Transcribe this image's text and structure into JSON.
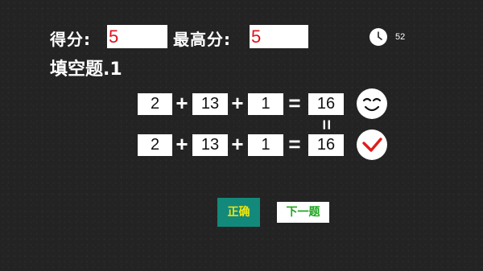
{
  "score": {
    "label": "得分:",
    "value": "5"
  },
  "highscore": {
    "label": "最高分:",
    "value": "5"
  },
  "timer": {
    "seconds": "52",
    "icon": "clock-icon"
  },
  "question_title": "填空题.1",
  "equations": [
    {
      "a": "2",
      "op1": "+",
      "b": "13",
      "op2": "+",
      "c": "1",
      "eq": "=",
      "result": "16",
      "face": "smile-icon"
    },
    {
      "a": "2",
      "op1": "+",
      "b": "13",
      "op2": "+",
      "c": "1",
      "eq": "=",
      "result": "16",
      "face": "check-icon"
    }
  ],
  "equals_between": "=",
  "buttons": {
    "correct_label": "正确",
    "next_label": "下一题"
  },
  "colors": {
    "background": "#232323",
    "score_text": "#e0101a",
    "correct_button_bg": "#12897a",
    "correct_button_text": "#f5e60a",
    "next_button_text": "#1fa41f",
    "check_mark": "#e01c1c"
  }
}
